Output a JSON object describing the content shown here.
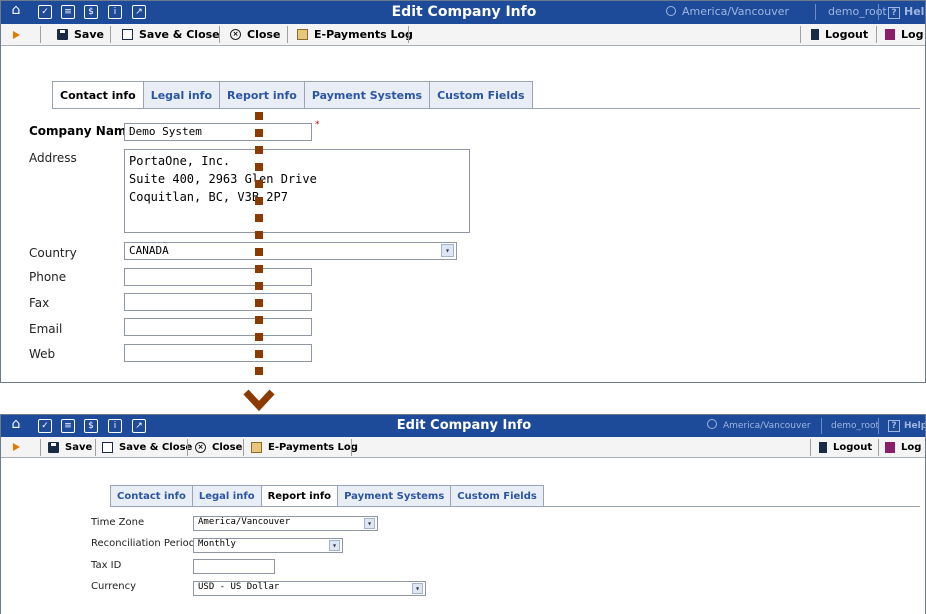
{
  "app_title": "Edit Company Info",
  "timezone": "America/Vancouver",
  "user": "demo_root",
  "help_label": "Help",
  "title_icons": [
    "home-icon",
    "checklist-icon",
    "list-icon",
    "money-icon",
    "info-icon",
    "chart-icon"
  ],
  "toolbar": {
    "save": "Save",
    "save_close": "Save & Close",
    "close": "Close",
    "epayments": "E-Payments Log",
    "logout": "Logout",
    "log": "Log"
  },
  "tabs": [
    "Contact info",
    "Legal info",
    "Report info",
    "Payment Systems",
    "Custom Fields"
  ],
  "contact_form": {
    "company_name_label": "Company Name",
    "company_name_value": "Demo System",
    "required_mark": "*",
    "address_label": "Address",
    "address_value": "PortaOne, Inc.\nSuite 400, 2963 Glen Drive\nCoquitlan, BC, V3B 2P7",
    "country_label": "Country",
    "country_value": "CANADA",
    "phone_label": "Phone",
    "phone_value": "",
    "fax_label": "Fax",
    "fax_value": "",
    "email_label": "Email",
    "email_value": "",
    "web_label": "Web",
    "web_value": ""
  },
  "report_form": {
    "timezone_label": "Time Zone",
    "timezone_value": "America/Vancouver",
    "reconciliation_label": "Reconciliation Period",
    "reconciliation_value": "Monthly",
    "taxid_label": "Tax ID",
    "taxid_value": "",
    "currency_label": "Currency",
    "currency_value": "USD - US Dollar"
  },
  "colors": {
    "titlebar": "#1e4a9a",
    "accent_orange": "#e07b00",
    "tab_link": "#2c55a2",
    "connector": "#8b3a00",
    "required": "#cc0000"
  }
}
